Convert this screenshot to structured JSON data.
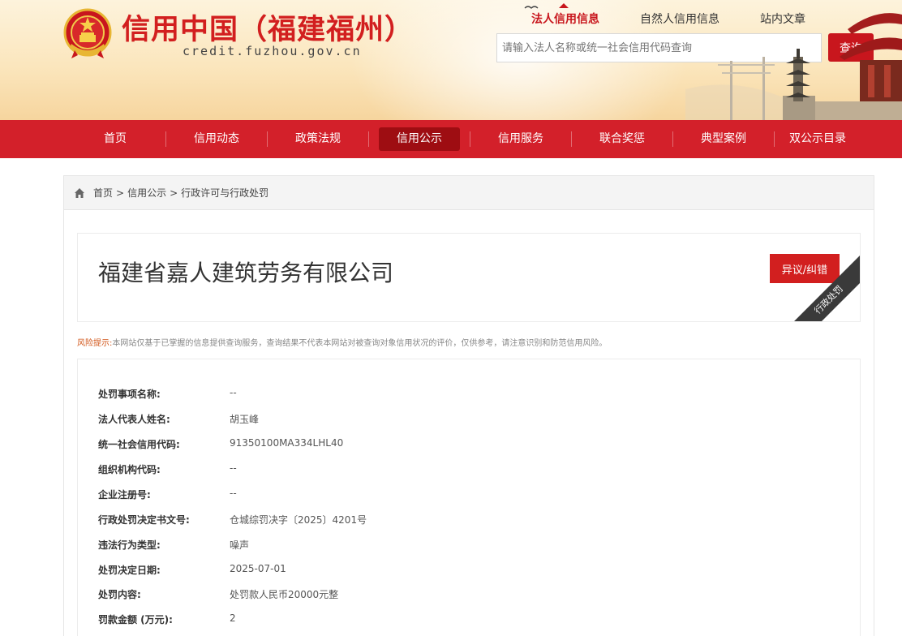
{
  "header": {
    "site_title": "信用中国（福建福州）",
    "site_domain": "credit.fuzhou.gov.cn",
    "search_tabs": [
      "法人信用信息",
      "自然人信用信息",
      "站内文章"
    ],
    "search_placeholder": "请输入法人名称或统一社会信用代码查询",
    "search_button": "查询"
  },
  "nav": {
    "items": [
      "首页",
      "信用动态",
      "政策法规",
      "信用公示",
      "信用服务",
      "联合奖惩",
      "典型案例",
      "双公示目录"
    ],
    "active_index": 3
  },
  "breadcrumb": [
    "首页",
    "信用公示",
    "行政许可与行政处罚"
  ],
  "company": {
    "name": "福建省嘉人建筑劳务有限公司",
    "objection_button": "异议/纠错",
    "ribbon": "行政处罚"
  },
  "risk": {
    "label": "风险提示:",
    "text": "本网站仅基于已掌握的信息提供查询服务，查询结果不代表本网站对被查询对象信用状况的评价，仅供参考，请注意识别和防范信用风险。"
  },
  "details": [
    {
      "label": "处罚事项名称:",
      "value": "--"
    },
    {
      "label": "法人代表人姓名:",
      "value": "胡玉峰"
    },
    {
      "label": "统一社会信用代码:",
      "value": "91350100MA334LHL40"
    },
    {
      "label": "组织机构代码:",
      "value": "--"
    },
    {
      "label": "企业注册号:",
      "value": "--"
    },
    {
      "label": "行政处罚决定书文号:",
      "value": "仓城综罚决字〔2025〕4201号"
    },
    {
      "label": "违法行为类型:",
      "value": "噪声"
    },
    {
      "label": "处罚决定日期:",
      "value": "2025-07-01"
    },
    {
      "label": "处罚内容:",
      "value": "处罚款人民币20000元整"
    },
    {
      "label": "罚款金额 (万元):",
      "value": "2"
    }
  ],
  "colors": {
    "brand_red": "#d3202a",
    "nav_active": "#9e0d12",
    "title_red": "#d21f1f"
  }
}
